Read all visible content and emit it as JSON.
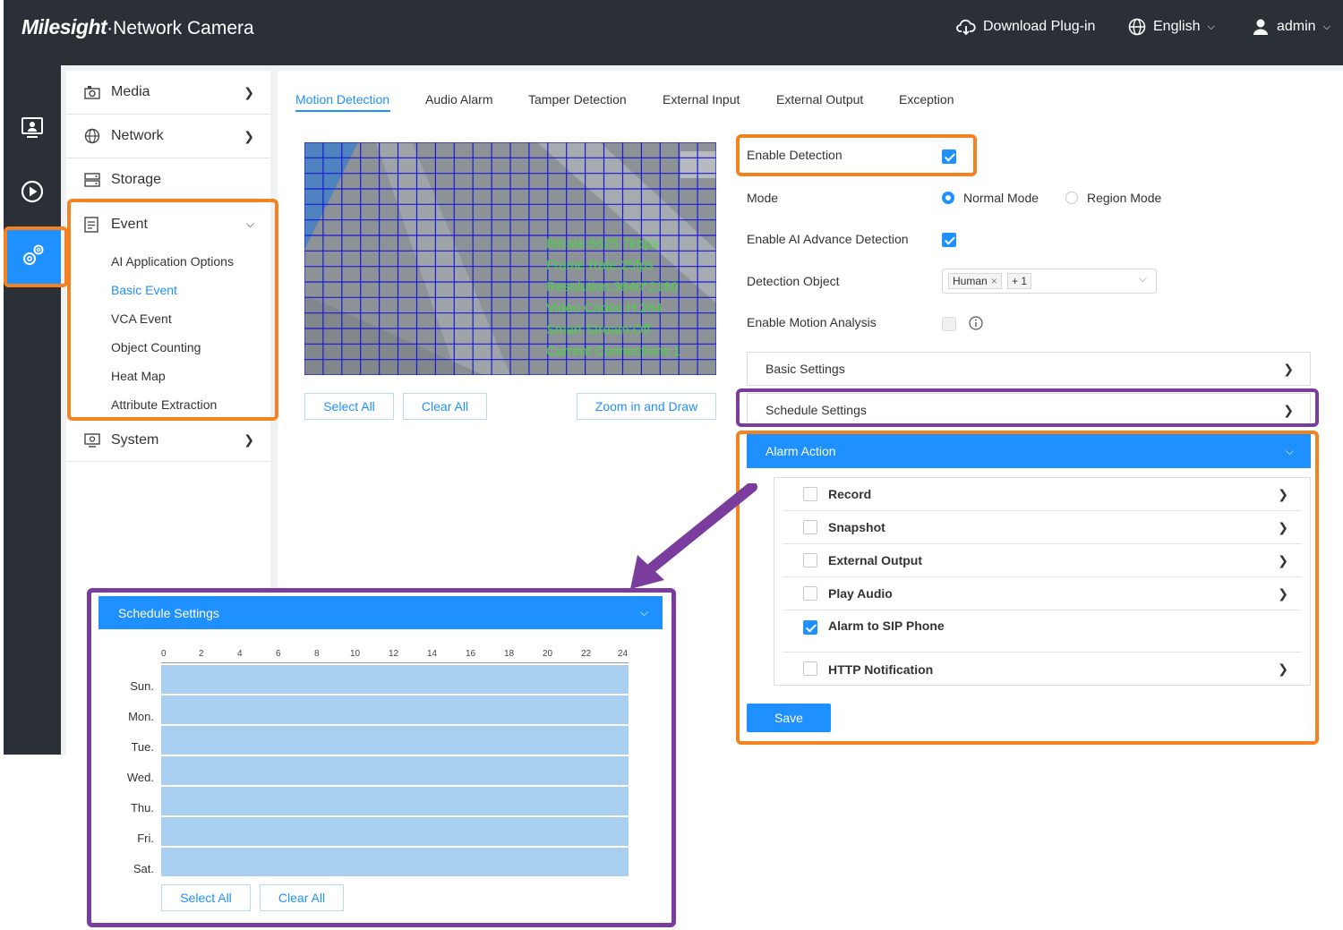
{
  "header": {
    "brand_logo": "Milesight",
    "brand_suffix": "·Network Camera",
    "download_label": "Download Plug-in",
    "language_label": "English",
    "user_label": "admin"
  },
  "menu": {
    "media": "Media",
    "network": "Network",
    "storage": "Storage",
    "event": "Event",
    "event_subitems": [
      "AI Application Options",
      "Basic Event",
      "VCA Event",
      "Object Counting",
      "Heat Map",
      "Attribute Extraction"
    ],
    "active_subitem": "Basic Event",
    "system": "System"
  },
  "tabs": [
    "Motion Detection",
    "Audio Alarm",
    "Tamper Detection",
    "External Input",
    "External Output",
    "Exception"
  ],
  "active_tab": "Motion Detection",
  "video": {
    "osd": [
      "Bitrate:6625.7kbps",
      "Frame Rate:25fps",
      "Resolution:3840*2160",
      "Video Codec:H.264",
      "Smart Stream:Off",
      "Current Connections:1"
    ],
    "select_all": "Select All",
    "clear_all": "Clear All",
    "zoom_draw": "Zoom in and Draw"
  },
  "form": {
    "enable_detection_label": "Enable Detection",
    "enable_detection": true,
    "mode_label": "Mode",
    "mode_normal": "Normal Mode",
    "mode_region": "Region Mode",
    "mode_selected": "Normal Mode",
    "ai_advance_label": "Enable AI Advance Detection",
    "ai_advance": true,
    "detection_object_label": "Detection Object",
    "detection_object_tag": "Human",
    "detection_object_more": "+ 1",
    "motion_analysis_label": "Enable Motion Analysis",
    "motion_analysis": false
  },
  "sections": {
    "basic_settings": "Basic Settings",
    "schedule_settings": "Schedule Settings",
    "alarm_action": "Alarm Action"
  },
  "alarm_actions": [
    {
      "label": "Record",
      "checked": false,
      "has_arrow": true
    },
    {
      "label": "Snapshot",
      "checked": false,
      "has_arrow": true
    },
    {
      "label": "External Output",
      "checked": false,
      "has_arrow": true
    },
    {
      "label": "Play Audio",
      "checked": false,
      "has_arrow": true
    },
    {
      "label": "Alarm to SIP Phone",
      "checked": true,
      "has_arrow": false
    },
    {
      "label": "HTTP Notification",
      "checked": false,
      "has_arrow": true
    }
  ],
  "save_label": "Save",
  "schedule": {
    "title": "Schedule Settings",
    "hours": [
      "0",
      "2",
      "4",
      "6",
      "8",
      "10",
      "12",
      "14",
      "16",
      "18",
      "20",
      "22",
      "24"
    ],
    "days": [
      "Sun.",
      "Mon.",
      "Tue.",
      "Wed.",
      "Thu.",
      "Fri.",
      "Sat."
    ],
    "select_all": "Select All",
    "clear_all": "Clear All"
  },
  "colors": {
    "accent": "#1e90ff",
    "highlight_orange": "#f58220",
    "highlight_purple": "#7a3d9e",
    "schedule_fill": "#a9cff1",
    "topbar": "#2b2f36"
  }
}
